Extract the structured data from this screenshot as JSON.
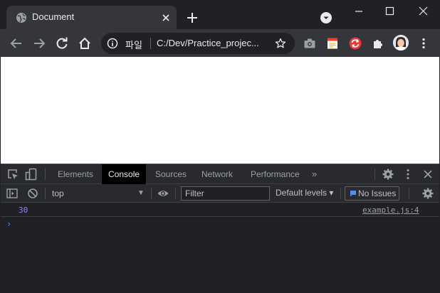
{
  "browser": {
    "tab": {
      "title": "Document",
      "favicon": "globe-icon",
      "close_icon": "close-icon"
    },
    "new_tab_icon": "plus-icon",
    "window_controls": [
      "minimize-icon",
      "maximize-icon",
      "close-icon"
    ],
    "toolbar": {
      "back_icon": "arrow-left-icon",
      "forward_icon": "arrow-right-icon",
      "reload_icon": "reload-icon",
      "home_icon": "home-icon",
      "address": {
        "scheme_label": "파일",
        "url": "C:/Dev/Practice_projec..."
      },
      "extensions": [
        "camera-icon",
        "note-icon",
        "sync-extension-icon",
        "puzzle-icon",
        "avatar",
        "menu-icon"
      ]
    }
  },
  "devtools": {
    "tabs": [
      {
        "label": "Elements",
        "active": false
      },
      {
        "label": "Console",
        "active": true
      },
      {
        "label": "Sources",
        "active": false
      },
      {
        "label": "Network",
        "active": false
      },
      {
        "label": "Performance",
        "active": false
      }
    ],
    "more_tabs": "»",
    "console_toolbar": {
      "context": "top",
      "filter_placeholder": "Filter",
      "levels": "Default levels ▾",
      "issues": "No Issues"
    },
    "logs": [
      {
        "value": "30",
        "source": "example.js:4"
      }
    ],
    "prompt": "›"
  },
  "colors": {
    "accent": "#8ab4f8",
    "log_number": "#9980ff",
    "prompt": "#4e8ef7",
    "active_tab_bg": "#000000"
  }
}
